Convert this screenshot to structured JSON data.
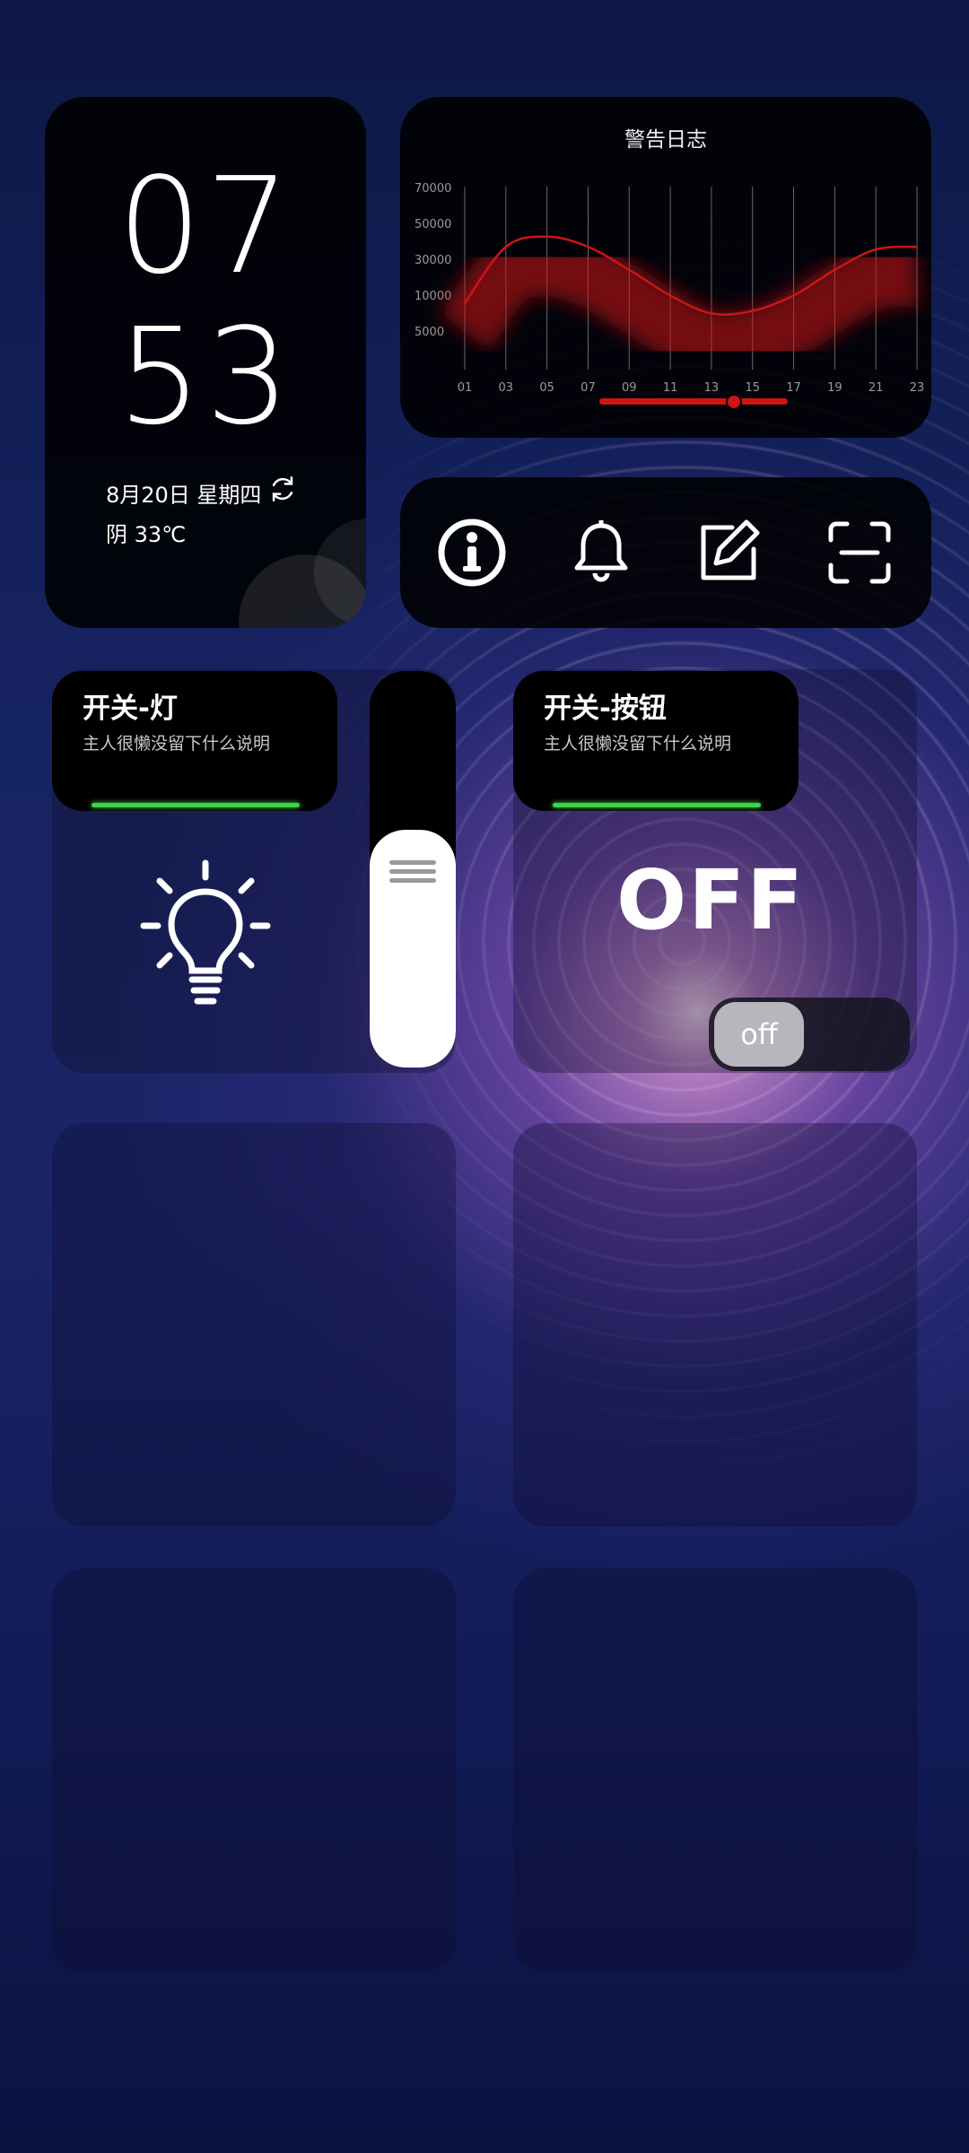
{
  "clock": {
    "hour": "07",
    "minute": "53",
    "date": "8月20日 星期四",
    "weather": "阴 33℃"
  },
  "chart_data": {
    "type": "area",
    "title": "警告日志",
    "categories": [
      "01",
      "03",
      "05",
      "07",
      "09",
      "11",
      "13",
      "15",
      "17",
      "19",
      "21",
      "23"
    ],
    "y_ticks": [
      "70000",
      "50000",
      "30000",
      "10000",
      "5000"
    ],
    "series": [
      {
        "values": [
          21000,
          43000,
          47000,
          43000,
          34000,
          24000,
          17000,
          18000,
          24000,
          34000,
          42000,
          43000
        ]
      }
    ],
    "series_color": "#d11313",
    "grid": "vertical"
  },
  "icon_bar": {
    "items": [
      {
        "name": "info-icon"
      },
      {
        "name": "bell-icon"
      },
      {
        "name": "edit-icon"
      },
      {
        "name": "scan-icon"
      }
    ]
  },
  "light_switch": {
    "title": "开关-灯",
    "description": "主人很懒没留下什么说明",
    "level": 0.6
  },
  "button_switch": {
    "title": "开关-按钮",
    "description": "主人很懒没留下什么说明",
    "state_text": "OFF",
    "toggle_label": "off"
  }
}
